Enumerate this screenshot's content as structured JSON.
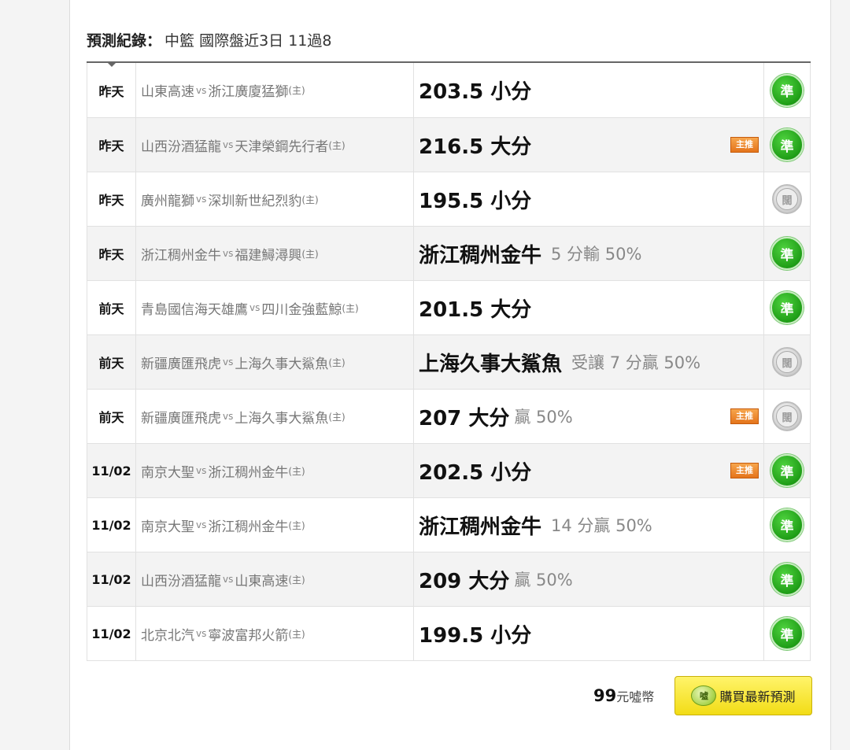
{
  "heading": {
    "label": "預測紀錄",
    "colon": "：",
    "text": "中籃 國際盤近3日 11過8"
  },
  "badge_text": "主推",
  "home_mark": "(主)",
  "vs_text": "vs",
  "result_labels": {
    "win": "準",
    "pending": "闊"
  },
  "rows": [
    {
      "date": "昨天",
      "away": "山東高速",
      "home": "浙江廣廈猛獅",
      "pick": "203.5 小分",
      "detail": "",
      "featured": false,
      "result": "win"
    },
    {
      "date": "昨天",
      "away": "山西汾酒猛龍",
      "home": "天津榮鋼先行者",
      "pick": "216.5 大分",
      "detail": "",
      "featured": true,
      "result": "win"
    },
    {
      "date": "昨天",
      "away": "廣州龍獅",
      "home": "深圳新世紀烈豹",
      "pick": "195.5 小分",
      "detail": "",
      "featured": false,
      "result": "pending"
    },
    {
      "date": "昨天",
      "away": "浙江稠州金牛",
      "home": "福建鱘潯興",
      "pick": "浙江稠州金牛",
      "detail": "5 分輸 50%",
      "featured": false,
      "result": "win"
    },
    {
      "date": "前天",
      "away": "青島國信海天雄鷹",
      "home": "四川金強藍鯨",
      "pick": "201.5 大分",
      "detail": "",
      "featured": false,
      "result": "win"
    },
    {
      "date": "前天",
      "away": "新疆廣匯飛虎",
      "home": "上海久事大鯊魚",
      "pick": "上海久事大鯊魚",
      "detail": "受讓 7 分贏 50%",
      "featured": false,
      "result": "pending"
    },
    {
      "date": "前天",
      "away": "新疆廣匯飛虎",
      "home": "上海久事大鯊魚",
      "pick": "207 大分",
      "detail": "贏 50%",
      "featured": true,
      "result": "pending"
    },
    {
      "date": "11/02",
      "away": "南京大聖",
      "home": "浙江稠州金牛",
      "pick": "202.5 小分",
      "detail": "",
      "featured": true,
      "result": "win"
    },
    {
      "date": "11/02",
      "away": "南京大聖",
      "home": "浙江稠州金牛",
      "pick": "浙江稠州金牛",
      "detail": "14 分贏 50%",
      "featured": false,
      "result": "win"
    },
    {
      "date": "11/02",
      "away": "山西汾酒猛龍",
      "home": "山東高速",
      "pick": "209 大分",
      "detail": "贏 50%",
      "featured": false,
      "result": "win"
    },
    {
      "date": "11/02",
      "away": "北京北汽",
      "home": "寧波富邦火箭",
      "pick": "199.5 小分",
      "detail": "",
      "featured": false,
      "result": "win"
    }
  ],
  "footer": {
    "price": "99",
    "unit": "元噓幣",
    "buy_label": "購買最新預測",
    "coin_text": "噓"
  },
  "colors": {
    "win": "#1f9e17",
    "badge": "#e4741b",
    "button": "#f2dc16"
  }
}
